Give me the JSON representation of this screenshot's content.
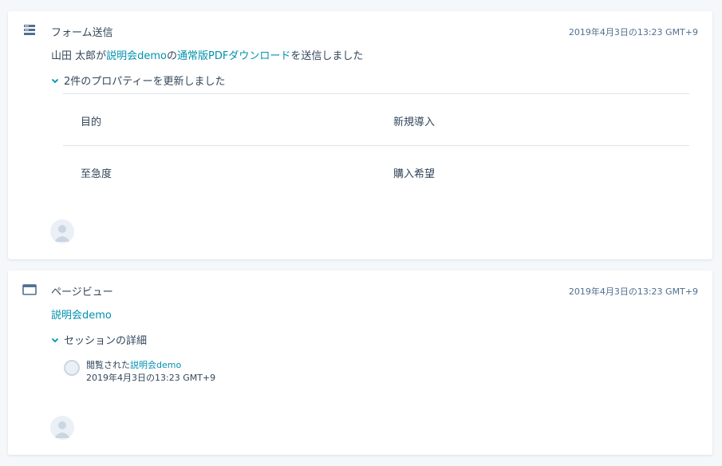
{
  "colors": {
    "background": "#f5f8fa",
    "text": "#33475b",
    "link": "#0091ae",
    "muted": "#516f90",
    "divider": "#dfe3eb"
  },
  "form_card": {
    "icon": "form-icon",
    "type_label": "フォーム送信",
    "timestamp": "2019年4月3日の13:23 GMT+9",
    "summary": {
      "contact_part": "山田 太郎が",
      "page_link": "説明会demo",
      "connector": "の",
      "form_link": "通常版PDFダウンロード",
      "suffix": "を送信しました"
    },
    "toggle_label": "2件のプロパティーを更新しました",
    "properties": [
      {
        "name": "目的",
        "value": "新規導入"
      },
      {
        "name": "至急度",
        "value": "購入希望"
      }
    ]
  },
  "pageview_card": {
    "icon": "browser-window-icon",
    "type_label": "ページビュー",
    "timestamp": "2019年4月3日の13:23 GMT+9",
    "page_link": "説明会demo",
    "toggle_label": "セッションの詳細",
    "session": {
      "viewed_prefix": "閲覧された",
      "viewed_link": "説明会demo",
      "time": "2019年4月3日の13:23 GMT+9"
    }
  }
}
